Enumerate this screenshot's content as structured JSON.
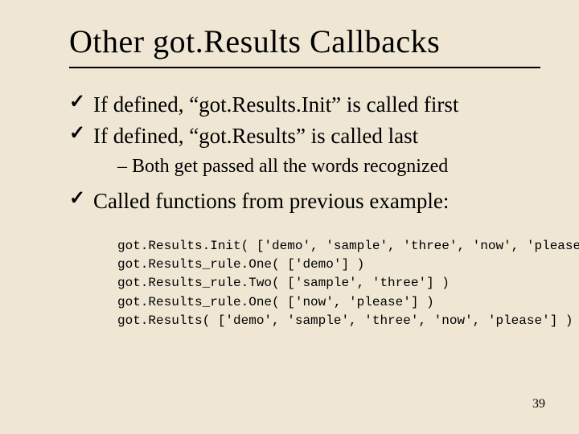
{
  "title": "Other got.Results Callbacks",
  "bullets": {
    "b1": "If defined, “got.Results.Init” is called first",
    "b2": "If defined, “got.Results” is called last",
    "sub1": "Both get passed all the words recognized",
    "b3": "Called functions from previous example:"
  },
  "code": {
    "l1": "got.Results.Init( ['demo', 'sample', 'three', 'now', 'please'] )",
    "l2": "got.Results_rule.One( ['demo'] )",
    "l3": "got.Results_rule.Two( ['sample', 'three'] )",
    "l4": "got.Results_rule.One( ['now', 'please'] )",
    "l5": "got.Results( ['demo', 'sample', 'three', 'now', 'please'] )"
  },
  "pagenum": "39",
  "glyphs": {
    "check": "✓"
  }
}
